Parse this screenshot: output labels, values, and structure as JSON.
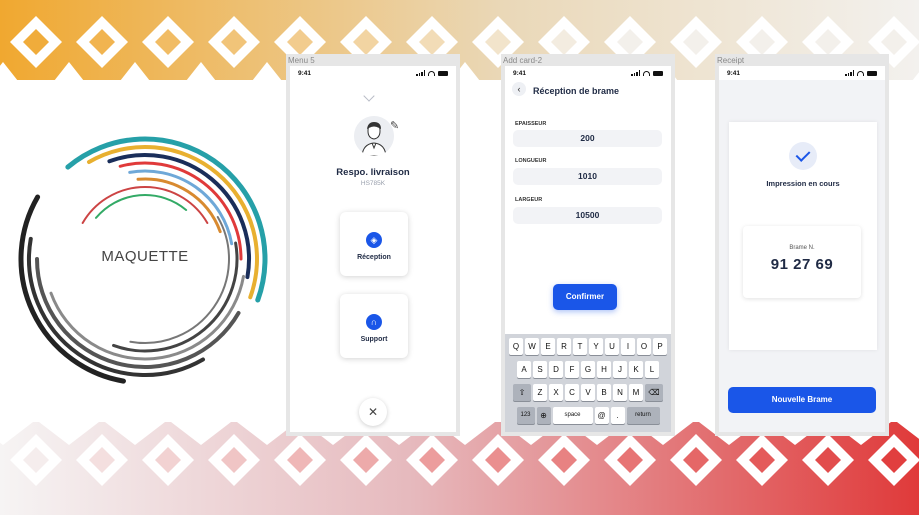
{
  "logo": {
    "text": "MAQUETTE"
  },
  "colors": {
    "accent": "#1a56e8",
    "band_top": "#f0a830",
    "band_bottom": "#e03a3a",
    "frame_bg": "#e6e6e6"
  },
  "screens": {
    "menu": {
      "frame_title": "Menu 5",
      "time": "9:41",
      "user_name": "Respo. livraison",
      "user_code": "HS785K",
      "items": [
        {
          "label": "Réception",
          "icon": "tag-icon"
        },
        {
          "label": "Support",
          "icon": "headset-icon"
        }
      ]
    },
    "add_card": {
      "frame_title": "Add card-2",
      "time": "9:41",
      "title": "Réception de brame",
      "fields": [
        {
          "label": "EPAISSEUR",
          "value": "200"
        },
        {
          "label": "LONGUEUR",
          "value": "1010"
        },
        {
          "label": "LARGEUR",
          "value": "10500"
        }
      ],
      "confirm_label": "Confirmer",
      "keyboard": {
        "row1": [
          "Q",
          "W",
          "E",
          "R",
          "T",
          "Y",
          "U",
          "I",
          "O",
          "P"
        ],
        "row2": [
          "A",
          "S",
          "D",
          "F",
          "G",
          "H",
          "J",
          "K",
          "L"
        ],
        "row3": [
          "Z",
          "X",
          "C",
          "V",
          "B",
          "N",
          "M"
        ],
        "num": "123",
        "space": "space",
        "at": "@",
        "dot": ".",
        "return": "return"
      }
    },
    "receipt": {
      "frame_title": "Receipt",
      "time": "9:41",
      "status": "Impression en cours",
      "number_label": "Brame N.",
      "number_value": "91 27 69",
      "button_label": "Nouvelle Brame"
    }
  }
}
